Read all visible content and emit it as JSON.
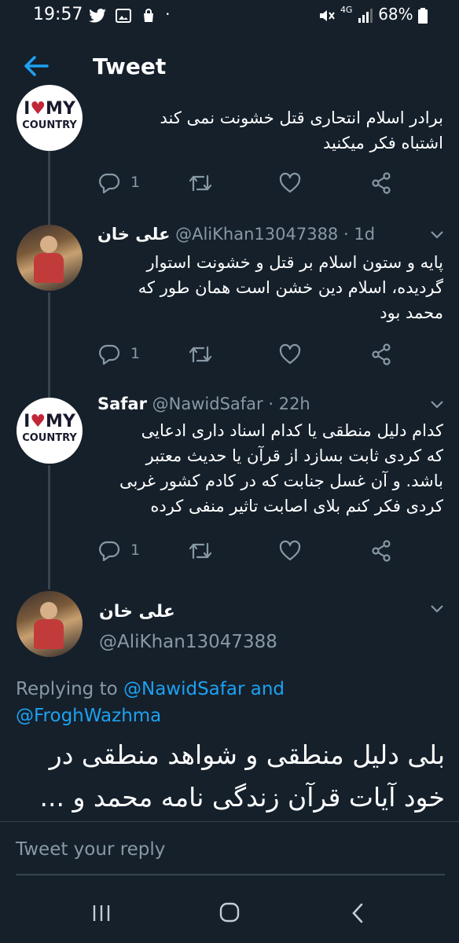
{
  "status_bar": {
    "time": "19:57",
    "network": "4G",
    "battery": "68%",
    "left_icons": [
      "twitter-icon",
      "image-icon",
      "bag-icon",
      "dot-icon"
    ],
    "right_icons": [
      "mute-icon",
      "signal-icon",
      "battery-icon"
    ]
  },
  "header": {
    "title": "Tweet",
    "back_icon": "arrow-left-icon"
  },
  "colors": {
    "background": "#15202b",
    "accent": "#1da1f2",
    "muted": "#8899a6",
    "divider": "#38444d"
  },
  "tweets": [
    {
      "avatar_type": "i-love-my-country",
      "avatar_text": {
        "line1_a": "I",
        "line1_heart": "♥",
        "line1_b": "MY",
        "line2": "COUNTRY"
      },
      "text": "برادر اسلام انتحاری قتل خشونت نمی کند\nاشتباه فکر میکنید",
      "reply_count": "1"
    },
    {
      "avatar_type": "photo",
      "name": "علی خان",
      "handle": "@AliKhan13047388",
      "time": "· 1d",
      "text": "پایه و ستون اسلام بر قتل و خشونت استوار\nگردیده، اسلام دین خشن است همان طور که\nمحمد بود",
      "reply_count": "1"
    },
    {
      "avatar_type": "i-love-my-country",
      "avatar_text": {
        "line1_a": "I",
        "line1_heart": "♥",
        "line1_b": "MY",
        "line2": "COUNTRY"
      },
      "name": "Safar",
      "handle": "@NawidSafar",
      "time": "· 22h",
      "text": "کدام دلیل منطقی یا کدام اسناد داری ادعایی\nکه کردی ثابت بسازد از قرآن یا حدیث معتبر\nباشد. و آن غسل جنابت که در کادم کشور غربی\nکردی فکر کنم بلای اصابت تاثیر منفی کرده",
      "reply_count": "1"
    }
  ],
  "main_tweet": {
    "name": "علی خان",
    "handle": "@AliKhan13047388",
    "replying_prefix": "Replying to ",
    "replying_user1": "@NawidSafar",
    "replying_and": " and",
    "replying_user2": "@FroghWazhma",
    "text": "بلی دلیل منطقی و شواهد منطقی در\nخود آیات قرآن زندگی نامه محمد و ..."
  },
  "reply_box": {
    "placeholder": "Tweet your reply"
  },
  "action_icons": [
    "reply-icon",
    "retweet-icon",
    "like-icon",
    "share-icon"
  ],
  "nav_icons": [
    "recents-icon",
    "home-icon",
    "back-icon"
  ]
}
